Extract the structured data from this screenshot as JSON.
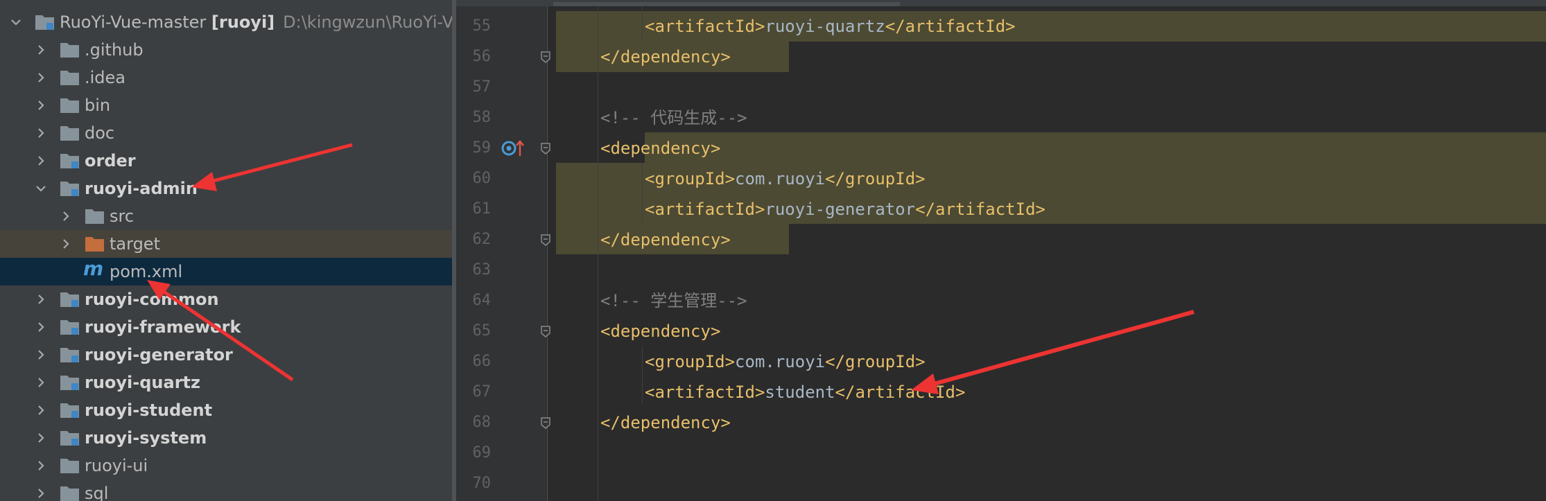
{
  "project_tree": {
    "root": {
      "name": "RuoYi-Vue-master",
      "module": "[ruoyi]",
      "path": "D:\\kingwzun\\RuoYi-Vu"
    },
    "items": [
      {
        "label": ".github"
      },
      {
        "label": ".idea"
      },
      {
        "label": "bin"
      },
      {
        "label": "doc"
      },
      {
        "label": "order"
      },
      {
        "label": "ruoyi-admin"
      },
      {
        "label": "src"
      },
      {
        "label": "target"
      },
      {
        "label": "pom.xml"
      },
      {
        "label": "ruoyi-common"
      },
      {
        "label": "ruoyi-framework"
      },
      {
        "label": "ruoyi-generator"
      },
      {
        "label": "ruoyi-quartz"
      },
      {
        "label": "ruoyi-student"
      },
      {
        "label": "ruoyi-system"
      },
      {
        "label": "ruoyi-ui"
      },
      {
        "label": "sql"
      }
    ],
    "maven_glyph": "m",
    "icons": {
      "folder": "folder-icon",
      "module": "module-folder-icon",
      "excluded": "excluded-folder-icon",
      "maven": "maven-file-icon"
    }
  },
  "editor": {
    "line_numbers": [
      "55",
      "56",
      "57",
      "58",
      "59",
      "60",
      "61",
      "62",
      "63",
      "64",
      "65",
      "66",
      "67",
      "68",
      "69",
      "70"
    ],
    "lines": [
      {
        "open": "<artifactId>",
        "text": "ruoyi-quartz",
        "close": "</artifactId>"
      },
      {
        "open": "</dependency>"
      },
      {},
      {
        "comment": "<!-- 代码生成-->"
      },
      {
        "open": "<dependency>"
      },
      {
        "open": "<groupId>",
        "text": "com.ruoyi",
        "close": "</groupId>"
      },
      {
        "open": "<artifactId>",
        "text": "ruoyi-generator",
        "close": "</artifactId>"
      },
      {
        "open": "</dependency>"
      },
      {},
      {
        "comment": "<!-- 学生管理-->"
      },
      {
        "open": "<dependency>"
      },
      {
        "open": "<groupId>",
        "text": "com.ruoyi",
        "close": "</groupId>"
      },
      {
        "open": "<artifactId>",
        "text": "student",
        "close": "</artifactId>"
      },
      {
        "open": "</dependency>"
      },
      {},
      {}
    ]
  },
  "colors": {
    "tree_bg": "#3c3f41",
    "editor_bg": "#2b2b2b",
    "selection": "#0d293e",
    "highlight": "#4c4a33",
    "xml_tag": "#e8bf6a",
    "annotation_arrow": "#ee3333"
  }
}
